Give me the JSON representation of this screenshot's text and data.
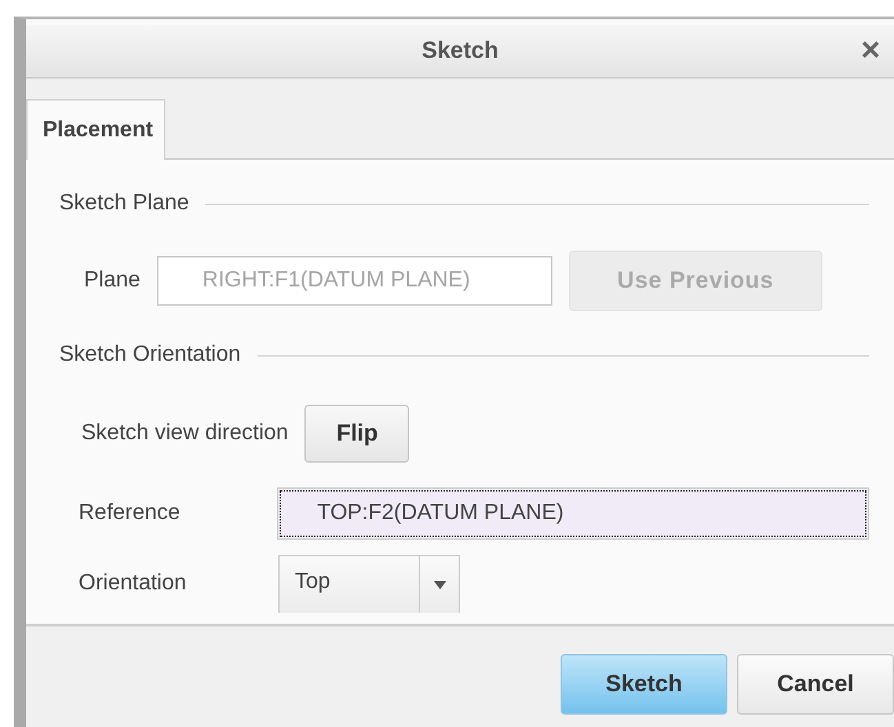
{
  "window": {
    "title": "Sketch",
    "close": "×"
  },
  "tabs": [
    {
      "label": "Placement",
      "selected": true
    }
  ],
  "sketch_plane": {
    "title": "Sketch Plane",
    "plane": {
      "label": "Plane",
      "value": "RIGHT:F1(DATUM PLANE)",
      "disabled": true
    },
    "use_previous": {
      "label": "Use Previous",
      "disabled": true
    }
  },
  "sketch_orientation": {
    "title": "Sketch Orientation",
    "view_direction": {
      "label": "Sketch view direction",
      "button": "Flip"
    },
    "reference": {
      "label": "Reference",
      "value": "TOP:F2(DATUM PLANE)",
      "focused": true
    },
    "orientation": {
      "label": "Orientation",
      "value": "Top"
    }
  },
  "buttons": [
    {
      "label": "Sketch",
      "kind": "primary"
    },
    {
      "label": "Cancel",
      "kind": "normal"
    }
  ]
}
